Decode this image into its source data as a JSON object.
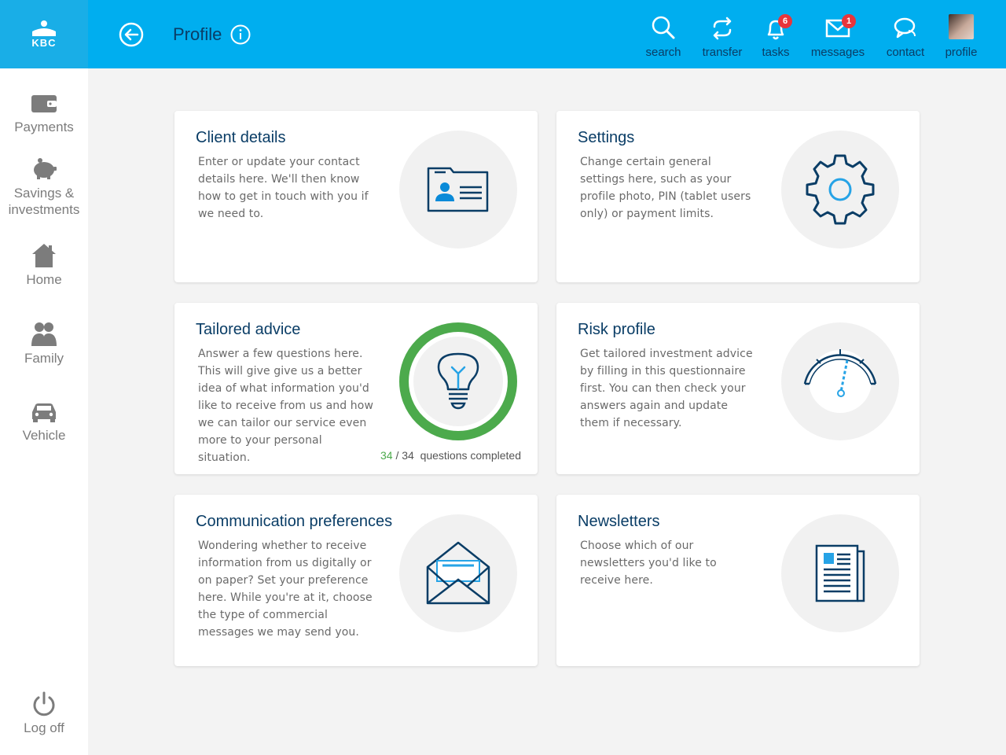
{
  "brand": {
    "logo_text": "KBC"
  },
  "header": {
    "title": "Profile",
    "nav": [
      {
        "label": "search",
        "icon": "search-icon"
      },
      {
        "label": "transfer",
        "icon": "transfer-icon"
      },
      {
        "label": "tasks",
        "icon": "bell-icon",
        "badge": "6"
      },
      {
        "label": "messages",
        "icon": "envelope-icon",
        "badge": "1"
      },
      {
        "label": "contact",
        "icon": "chat-icon"
      },
      {
        "label": "profile",
        "icon": "avatar"
      }
    ]
  },
  "sidebar": {
    "items": [
      {
        "label": "Payments",
        "icon": "wallet-icon"
      },
      {
        "label": "Savings & investments",
        "icon": "piggy-bank-icon"
      },
      {
        "label": "Home",
        "icon": "house-icon"
      },
      {
        "label": "Family",
        "icon": "family-icon"
      },
      {
        "label": "Vehicle",
        "icon": "car-icon"
      }
    ],
    "logoff": {
      "label": "Log off",
      "icon": "power-icon"
    }
  },
  "cards": [
    {
      "title": "Client details",
      "desc": "Enter or update your contact details here. We'll then know how to get in touch with you if we need to.",
      "icon": "id-card-icon"
    },
    {
      "title": "Settings",
      "desc": "Change certain general settings here, such as your profile photo, PIN (tablet users only) or payment limits.",
      "icon": "gear-icon"
    },
    {
      "title": "Tailored advice",
      "desc": "Answer a few questions here. This will give give us a better idea of what information you'd like to receive from us and how we can tailor our service even more to your personal situation.",
      "icon": "lightbulb-icon",
      "progress": {
        "done": "34",
        "separator": "/",
        "total": "34",
        "label": "questions completed",
        "fraction": 1.0
      }
    },
    {
      "title": "Risk profile",
      "desc": "Get tailored investment advice by filling in this questionnaire first. You can then check your answers again and update them if necessary.",
      "icon": "gauge-icon"
    },
    {
      "title": "Communication preferences",
      "desc": "Wondering whether to receive information from us digitally or on paper? Set your preference here. While you're at it, choose the type of commercial messages we may send you.",
      "icon": "open-envelope-icon"
    },
    {
      "title": "Newsletters",
      "desc": "Choose which of our newsletters you'd like to receive here.",
      "icon": "newspaper-icon"
    }
  ],
  "colors": {
    "accent": "#00aeef",
    "navy": "#0a3d66",
    "progress": "#4caa4c",
    "badge": "#e8353b"
  }
}
